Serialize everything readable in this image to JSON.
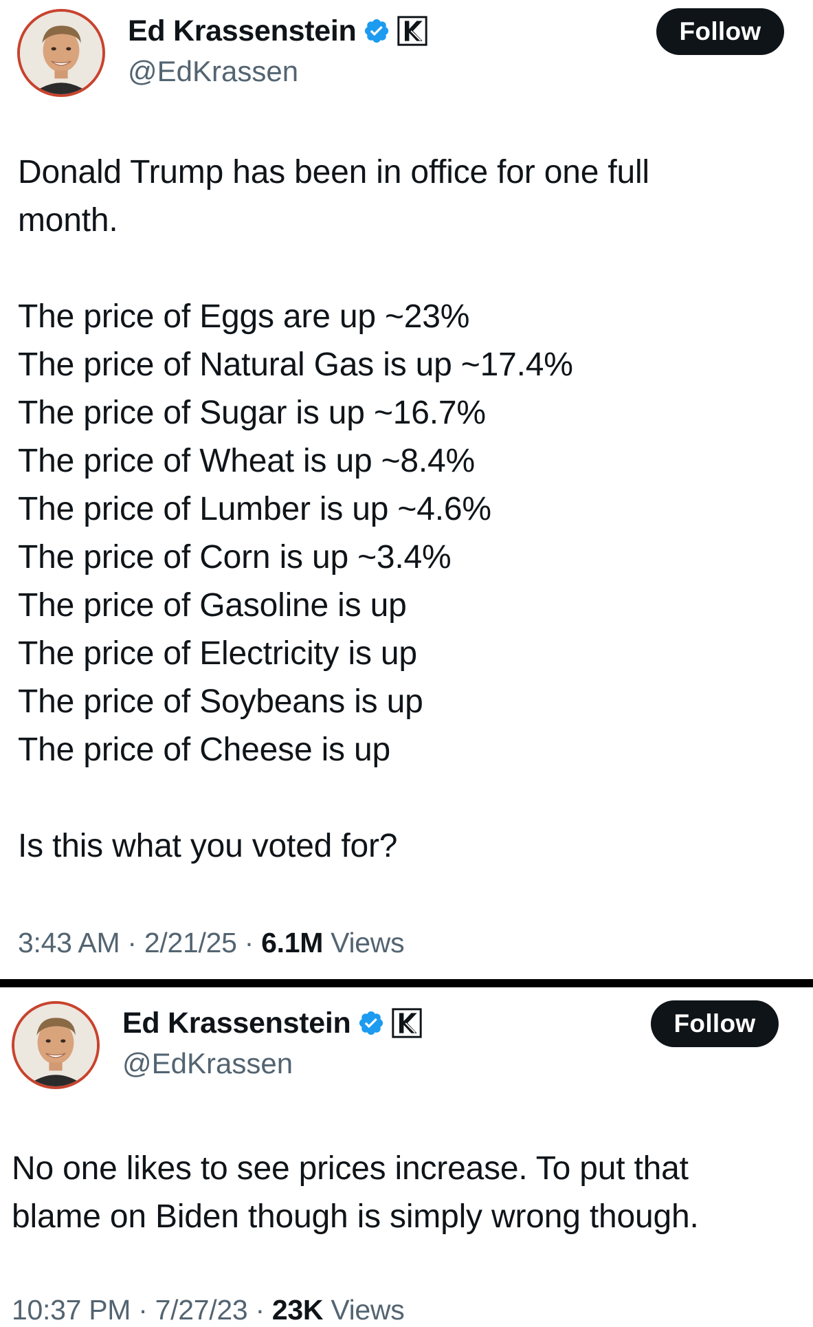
{
  "colors": {
    "text": "#0f1419",
    "secondary_text": "#536471",
    "verified_blue": "#1d9bf0",
    "avatar_ring": "#c8432e",
    "follow_button_bg": "#0f1419",
    "divider": "#000000"
  },
  "tweets": [
    {
      "author": {
        "display_name": "Ed Krassenstein",
        "handle": "@EdKrassen",
        "avatar_icon": "profile-photo",
        "verified_icon": "verified-badge-icon",
        "affiliate_icon": "k-affiliate-badge-icon"
      },
      "follow_label": "Follow",
      "text": {
        "intro": [
          "Donald Trump has been in office for one full",
          "month."
        ],
        "items": [
          "The price of Eggs are up ~23%",
          "The price of Natural Gas is up ~17.4%",
          "The price of Sugar is up ~16.7%",
          "The price of Wheat is up ~8.4%",
          "The price of Lumber is up ~4.6%",
          "The price of Corn is up ~3.4%",
          "The price of Gasoline is up",
          "The price of Electricity is up",
          "The price of Soybeans is up",
          "The price of Cheese is up"
        ],
        "closing": "Is this what you voted for?"
      },
      "meta": {
        "time": "3:43 AM",
        "date": "2/21/25",
        "separator": "·",
        "views_count": "6.1M",
        "views_label": "Views"
      }
    },
    {
      "author": {
        "display_name": "Ed Krassenstein",
        "handle": "@EdKrassen",
        "avatar_icon": "profile-photo",
        "verified_icon": "verified-badge-icon",
        "affiliate_icon": "k-affiliate-badge-icon"
      },
      "follow_label": "Follow",
      "text": {
        "lines": [
          "No one likes to see prices increase. To put that",
          "blame on Biden though is simply wrong though."
        ]
      },
      "meta": {
        "time": "10:37 PM",
        "date": "7/27/23",
        "separator": "·",
        "views_count": "23K",
        "views_label": "Views"
      }
    }
  ]
}
